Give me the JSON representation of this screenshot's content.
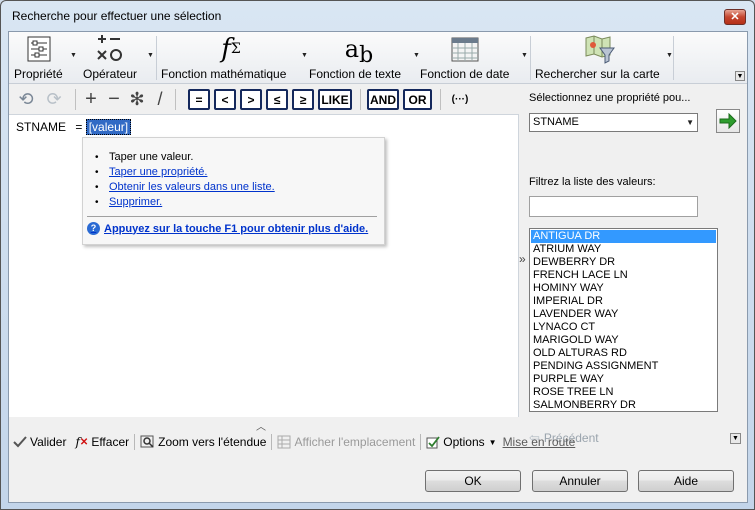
{
  "window": {
    "title": "Recherche pour effectuer une sélection",
    "close_label": "✕"
  },
  "ribbon": {
    "groups": [
      {
        "label": "Propriété",
        "icon": "property-list-icon"
      },
      {
        "label": "Opérateur",
        "icon": "operator-icon"
      },
      {
        "label": "Fonction mathématique",
        "icon": "math-function-icon"
      },
      {
        "label": "Fonction de texte",
        "icon": "text-function-icon"
      },
      {
        "label": "Fonction de date",
        "icon": "calendar-icon"
      },
      {
        "label": "Rechercher sur la carte",
        "icon": "map-filter-icon"
      }
    ]
  },
  "operators": {
    "equal": "=",
    "less": "<",
    "greater": ">",
    "less_equal": "≤",
    "greater_equal": "≥",
    "like": "LIKE",
    "and": "AND",
    "or": "OR",
    "parens": "(···)"
  },
  "expression": {
    "property": "STNAME",
    "operator": "=",
    "token": "[valeur]"
  },
  "popup": {
    "items": [
      {
        "text": "Taper une valeur.",
        "is_link": false
      },
      {
        "text": "Taper une propriété.",
        "is_link": true
      },
      {
        "text": "Obtenir les valeurs dans une liste.",
        "is_link": true
      },
      {
        "text": "Supprimer.",
        "is_link": true
      }
    ],
    "help": "Appuyez sur la touche F1 pour obtenir plus d'aide."
  },
  "right_panel": {
    "select_label": "Sélectionnez une propriété pou...",
    "selected_property": "STNAME",
    "filter_label": "Filtrez la liste des valeurs:",
    "filter_value": "",
    "values": [
      "ANTIGUA DR",
      "ATRIUM WAY",
      "DEWBERRY DR",
      "FRENCH LACE LN",
      "HOMINY WAY",
      "IMPERIAL DR",
      "LAVENDER WAY",
      "LYNACO CT",
      "MARIGOLD WAY",
      "OLD ALTURAS RD",
      "PENDING ASSIGNMENT",
      "PURPLE WAY",
      "ROSE TREE LN",
      "SALMONBERRY DR"
    ],
    "selected_index": 0,
    "previous_label": "Précédent"
  },
  "bottom_bar": {
    "validate": "Valider",
    "clear": "Effacer",
    "zoom": "Zoom vers l'étendue",
    "show_location": "Afficher l'emplacement",
    "options": "Options",
    "getting_started": "Mise en route"
  },
  "buttons": {
    "ok": "OK",
    "cancel": "Annuler",
    "help": "Aide"
  },
  "colors": {
    "accent": "#316ac5",
    "selection": "#3399ff",
    "go_arrow": "#2e9d2e",
    "link": "#0033cc"
  }
}
